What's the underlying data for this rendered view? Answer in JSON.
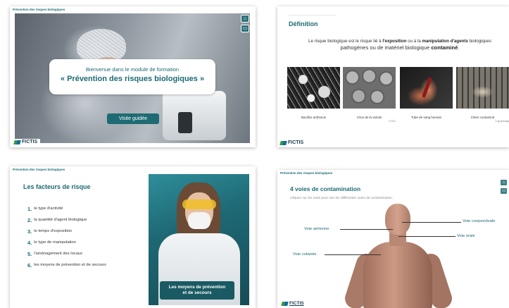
{
  "slide1": {
    "header": "Prévention des risques biologiques",
    "welcome_line": "Bienvenue dans le module de formation",
    "welcome_title": "« Prévention des risques biologiques »",
    "visit_button": "Visite guidée",
    "logo": "FICTIS"
  },
  "slide2": {
    "title": "Définition",
    "definition_part1": "Le risque biologique est le risque lié à ",
    "definition_bold1": "l'exposition",
    "definition_part2": " ou à la ",
    "definition_bold2": "manipulation d'agents",
    "definition_part3": " biologiques",
    "definition_line2_bold": "pathogènes",
    "definition_line2_part": " ou de matériel biologique ",
    "definition_bold3": "contaminé",
    "definition_end": ".",
    "images": [
      {
        "caption": "Bacillus anthracis",
        "credit": ""
      },
      {
        "caption": "Virus de la variole",
        "credit": "© CDC"
      },
      {
        "caption": "Tube de sang humain",
        "credit": ""
      },
      {
        "caption": "Chien contaminé",
        "credit": "© ga jennings"
      }
    ],
    "logo": "FICTIS"
  },
  "slide3": {
    "header": "Prévention des risques biologiques",
    "title": "Les facteurs de risque",
    "factors": [
      {
        "num": "1.",
        "label": "le type d'activité"
      },
      {
        "num": "2.",
        "label": "la quantité d'agent biologique"
      },
      {
        "num": "3.",
        "label": "le temps d'exposition"
      },
      {
        "num": "4.",
        "label": "le type de manipulation"
      },
      {
        "num": "5.",
        "label": "l'aménagement des locaux"
      },
      {
        "num": "6.",
        "label": "les moyens de prévention et de secours"
      }
    ],
    "button_line1": "Les moyens de prévention",
    "button_line2": "et de secours"
  },
  "slide4": {
    "header": "Prévention des risques biologiques",
    "title": "4 voies de contamination",
    "subtitle": "Cliquez sur les mots pour voir les différentes voies de contamination.",
    "routes": {
      "aerienne": "Voie aérienne",
      "conjonctivale": "Voie conjonctivale",
      "orale": "Voie orale",
      "cutanee": "Voie cutanée"
    },
    "logo": "FICTIS"
  },
  "icons": {
    "home": "home-icon",
    "subtitles": "subtitles-icon"
  },
  "colors": {
    "accent": "#1b6a73",
    "button": "#1e6b74"
  }
}
